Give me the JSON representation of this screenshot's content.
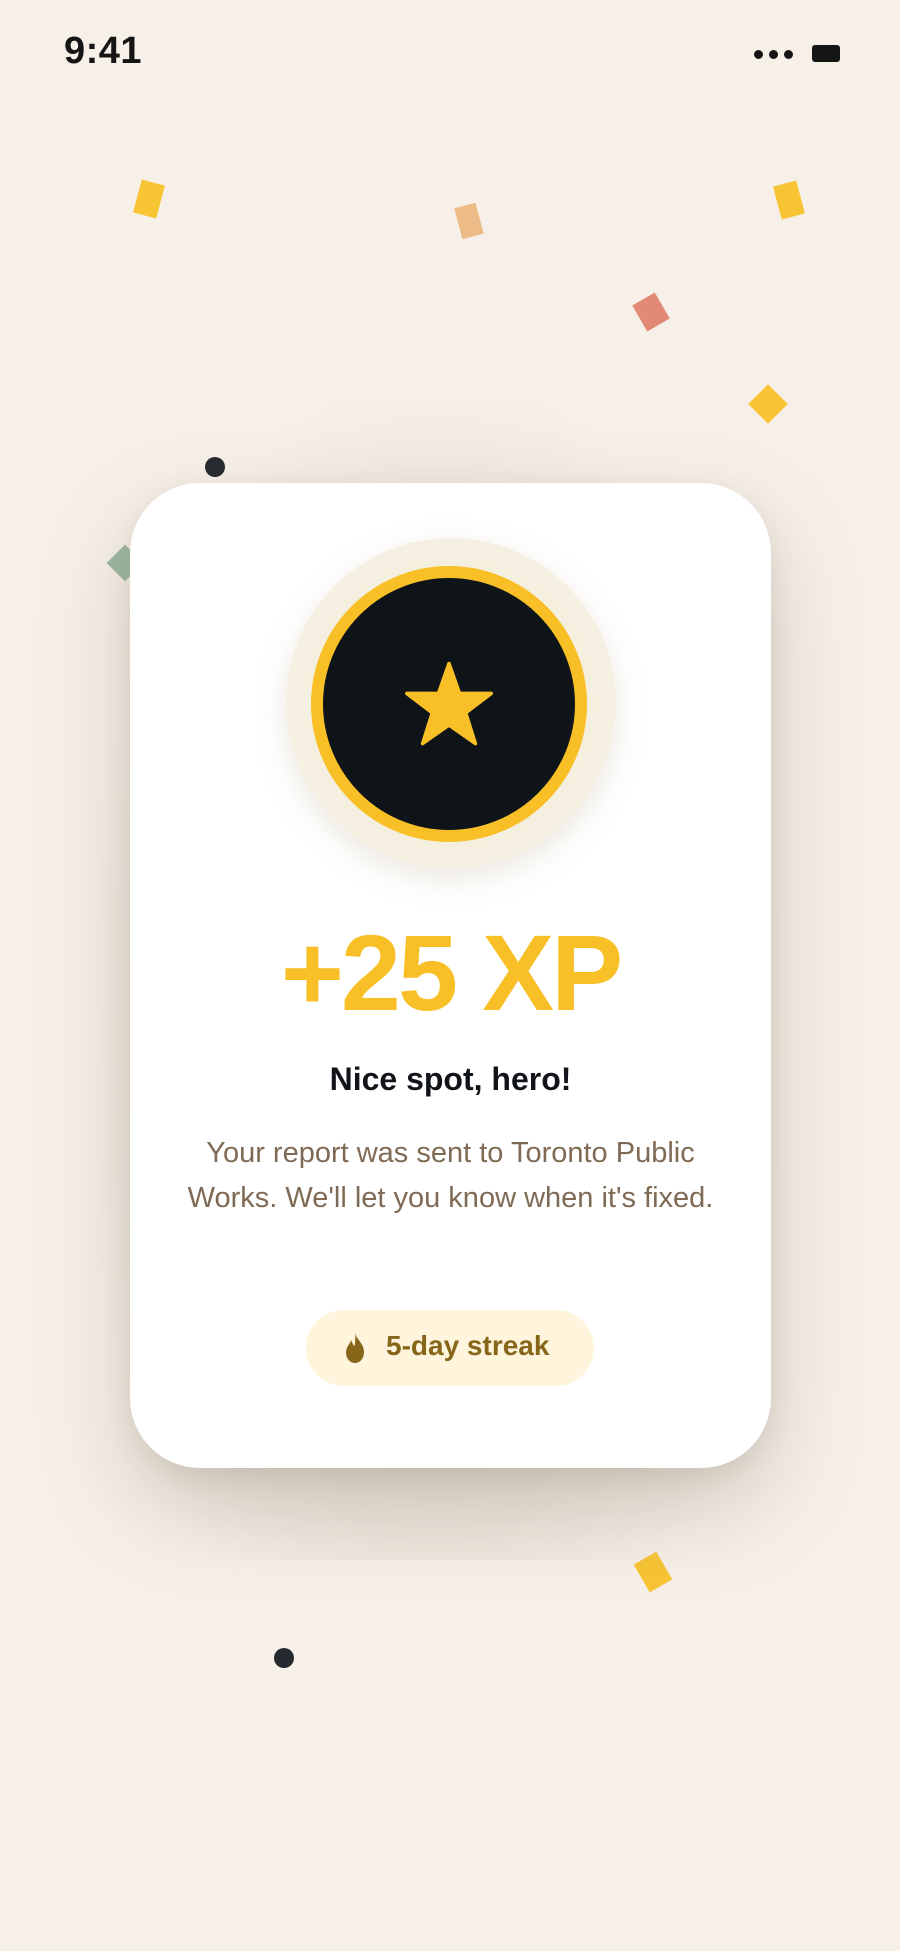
{
  "status_bar": {
    "time": "9:41"
  },
  "reward": {
    "xp_text": "+25 XP",
    "title": "Nice spot, hero!",
    "message": "Your report was sent to Toronto Public Works. We'll let you know when it's fixed.",
    "streak_label": "5-day streak"
  },
  "colors": {
    "background": "#F6F0E8",
    "accent_gold": "#F9BF26",
    "badge_dark": "#0F1419",
    "body_text": "#7F6A55",
    "streak_bg": "#FEF5DC",
    "streak_text": "#87661A"
  },
  "icons": {
    "badge": "star-icon",
    "streak": "flame-icon",
    "status_dots": "more-dots-icon",
    "status_battery": "battery-icon"
  }
}
